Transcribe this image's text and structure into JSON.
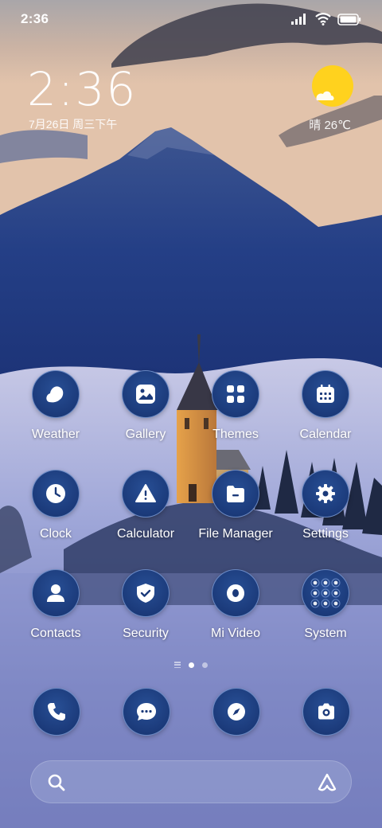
{
  "status_bar": {
    "time": "2:36",
    "icons": [
      "signal-icon",
      "wifi-icon",
      "battery-icon"
    ]
  },
  "clock_widget": {
    "time": "2:36",
    "date": "7月26日 周三下午",
    "weather": "晴 26℃",
    "weather_icon": "sun-cloud-icon"
  },
  "apps": [
    {
      "label": "Weather",
      "icon": "weather-icon"
    },
    {
      "label": "Gallery",
      "icon": "gallery-icon"
    },
    {
      "label": "Themes",
      "icon": "themes-icon"
    },
    {
      "label": "Calendar",
      "icon": "calendar-icon"
    },
    {
      "label": "Clock",
      "icon": "clock-icon"
    },
    {
      "label": "Calculator",
      "icon": "calculator-icon"
    },
    {
      "label": "File Manager",
      "icon": "file-manager-icon"
    },
    {
      "label": "Settings",
      "icon": "settings-icon"
    },
    {
      "label": "Contacts",
      "icon": "contacts-icon"
    },
    {
      "label": "Security",
      "icon": "security-icon"
    },
    {
      "label": "Mi Video",
      "icon": "mi-video-icon"
    },
    {
      "label": "System",
      "icon": "system-folder-icon"
    }
  ],
  "page_indicator": {
    "pages": 2,
    "active_page": 1
  },
  "dock": [
    "phone-icon",
    "messages-icon",
    "browser-icon",
    "camera-icon"
  ],
  "search_bar": {
    "left_icon": "search-icon",
    "right_icon": "assistant-icon"
  },
  "colors": {
    "icon_bg": "#1b3a7a",
    "sun": "#ffd21e"
  }
}
